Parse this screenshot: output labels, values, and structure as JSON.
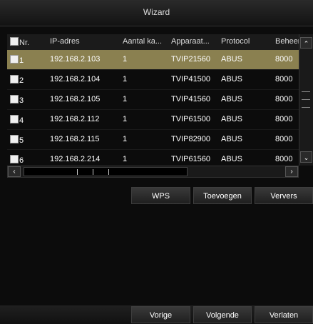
{
  "window": {
    "title": "Wizard"
  },
  "table": {
    "headers": [
      "Nr.",
      "IP-adres",
      "Aantal ka...",
      "Apparaat...",
      "Protocol",
      "Beheer"
    ],
    "rows": [
      {
        "nr": "1",
        "ip": "192.168.2.103",
        "count": "1",
        "device": "TVIP21560",
        "protocol": "ABUS",
        "port": "8000"
      },
      {
        "nr": "2",
        "ip": "192.168.2.104",
        "count": "1",
        "device": "TVIP41500",
        "protocol": "ABUS",
        "port": "8000"
      },
      {
        "nr": "3",
        "ip": "192.168.2.105",
        "count": "1",
        "device": "TVIP41560",
        "protocol": "ABUS",
        "port": "8000"
      },
      {
        "nr": "4",
        "ip": "192.168.2.112",
        "count": "1",
        "device": "TVIP61500",
        "protocol": "ABUS",
        "port": "8000"
      },
      {
        "nr": "5",
        "ip": "192.168.2.115",
        "count": "1",
        "device": "TVIP82900",
        "protocol": "ABUS",
        "port": "8000"
      },
      {
        "nr": "6",
        "ip": "192.168.2.214",
        "count": "1",
        "device": "TVIP61560",
        "protocol": "ABUS",
        "port": "8000"
      }
    ]
  },
  "actions": {
    "wps": "WPS",
    "add": "Toevoegen",
    "refresh": "Ververs"
  },
  "footer": {
    "prev": "Vorige",
    "next": "Volgende",
    "exit": "Verlaten"
  },
  "colors": {
    "selected_row": "#8a8050",
    "background": "#0c0c0c"
  }
}
